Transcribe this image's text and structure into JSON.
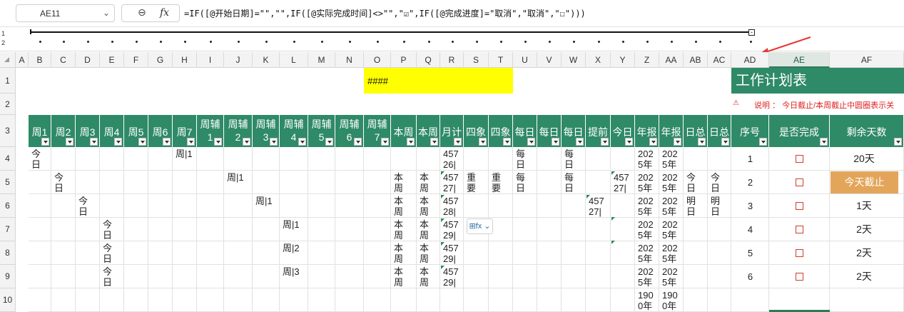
{
  "formula_bar": {
    "cell_ref": "AE11",
    "formula": "=IF([@开始日期]=\"\",\"\",IF([@实际完成时间]<>\"\",\"☑\",IF([@完成进度]=\"取消\",\"取消\",\"☐\")))"
  },
  "outline": {
    "levels": [
      "1",
      "2"
    ],
    "collapse_symbol": "-"
  },
  "columns": [
    "A",
    "B",
    "C",
    "D",
    "E",
    "F",
    "G",
    "H",
    "I",
    "J",
    "K",
    "L",
    "M",
    "N",
    "O",
    "P",
    "Q",
    "R",
    "S",
    "T",
    "U",
    "V",
    "W",
    "X",
    "Y",
    "Z",
    "AA",
    "AB",
    "AC",
    "AD",
    "AE",
    "AF"
  ],
  "rows": [
    "1",
    "2",
    "3",
    "4",
    "5",
    "6",
    "7",
    "8",
    "9",
    "10"
  ],
  "top": {
    "yellow_cell": "####",
    "title": "工作计划表",
    "note_icon": "⚠",
    "note": "说明 ： 今日截止/本周截止中圆圈表示关"
  },
  "headers": {
    "left": [
      "周1",
      "周2",
      "周3",
      "周4",
      "周5",
      "周6",
      "周7",
      "周辅1",
      "周辅2",
      "周辅3",
      "周辅4",
      "周辅5",
      "周辅6",
      "周辅7",
      "本周",
      "本周",
      "月计",
      "四象",
      "四象",
      "每日",
      "每日",
      "每日",
      "提前",
      "今日",
      "年报",
      "年报",
      "日总",
      "日总"
    ],
    "right": [
      "序号",
      "是否完成",
      "剩余天数"
    ]
  },
  "cells": {
    "r4": {
      "B": "今\n日",
      "H": "周|1",
      "R": "457\n26|",
      "U": "每\n日",
      "W": "每\n日",
      "Z": "202\n5年",
      "AA": "202\n5年"
    },
    "r5": {
      "C": "今\n日",
      "J": "周|1",
      "P": "本\n周",
      "Q": "本\n周",
      "R": "457\n27|",
      "S": "重\n要",
      "T": "重\n要",
      "U": "每\n日",
      "W": "每\n日",
      "Y": "457\n27|",
      "Z": "202\n5年",
      "AA": "202\n5年",
      "AB": "今\n日",
      "AC": "今\n日"
    },
    "r6": {
      "D": "今\n日",
      "K": "周|1",
      "P": "本\n周",
      "Q": "本\n周",
      "R": "457\n28|",
      "X": "457\n27|",
      "Z": "202\n5年",
      "AA": "202\n5年",
      "AB": "明\n日",
      "AC": "明\n日"
    },
    "r7": {
      "E": "今\n日",
      "L": "周|1",
      "P": "本\n周",
      "Q": "本\n周",
      "R": "457\n29|",
      "Z": "202\n5年",
      "AA": "202\n5年"
    },
    "r8": {
      "E": "今\n日",
      "L": "周|2",
      "P": "本\n周",
      "Q": "本\n周",
      "R": "457\n29|",
      "Z": "202\n5年",
      "AA": "202\n5年"
    },
    "r9": {
      "E": "今\n日",
      "L": "周|3",
      "P": "本\n周",
      "Q": "本\n周",
      "R": "457\n29|",
      "Z": "202\n5年",
      "AA": "202\n5年"
    },
    "r10": {
      "Z": "190\n0年",
      "AA": "190\n0年"
    }
  },
  "table_rows": [
    {
      "seq": "1",
      "done": "☐",
      "remaining": "20天",
      "highlight": false
    },
    {
      "seq": "2",
      "done": "☐",
      "remaining": "今天截止",
      "highlight": true
    },
    {
      "seq": "3",
      "done": "☐",
      "remaining": "1天",
      "highlight": false
    },
    {
      "seq": "4",
      "done": "☐",
      "remaining": "2天",
      "highlight": false
    },
    {
      "seq": "5",
      "done": "☐",
      "remaining": "2天",
      "highlight": false
    },
    {
      "seq": "6",
      "done": "☐",
      "remaining": "2天",
      "highlight": false
    }
  ],
  "quick_analysis": {
    "label": "⊞fx ⌄"
  },
  "colors": {
    "header_green": "#2f8a67",
    "yellow": "#ffff00",
    "today_orange": "#e3a55a",
    "checkbox_red": "#d23b2b",
    "arrow_red": "#e53935"
  }
}
